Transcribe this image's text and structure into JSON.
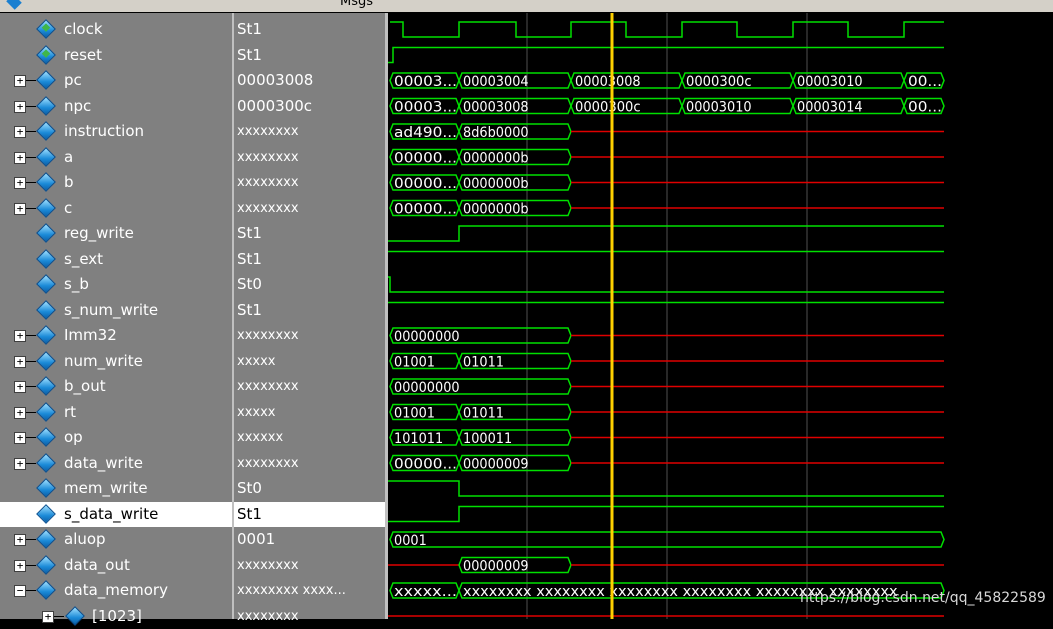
{
  "header": {
    "value_column_label": "Msgs"
  },
  "signals": [
    {
      "name": "clock",
      "value": "St1",
      "expandable": false,
      "icon": "clock-icon"
    },
    {
      "name": "reset",
      "value": "St1",
      "expandable": false,
      "icon": "clock-icon"
    },
    {
      "name": "pc",
      "value": "00003008",
      "expandable": true,
      "icon": "signal-icon"
    },
    {
      "name": "npc",
      "value": "0000300c",
      "expandable": true,
      "icon": "signal-icon"
    },
    {
      "name": "instruction",
      "value": "xxxxxxxx",
      "expandable": true,
      "icon": "signal-icon"
    },
    {
      "name": "a",
      "value": "xxxxxxxx",
      "expandable": true,
      "icon": "signal-icon"
    },
    {
      "name": "b",
      "value": "xxxxxxxx",
      "expandable": true,
      "icon": "signal-icon"
    },
    {
      "name": "c",
      "value": "xxxxxxxx",
      "expandable": true,
      "icon": "signal-icon"
    },
    {
      "name": "reg_write",
      "value": "St1",
      "expandable": false,
      "icon": "signal-icon"
    },
    {
      "name": "s_ext",
      "value": "St1",
      "expandable": false,
      "icon": "signal-icon"
    },
    {
      "name": "s_b",
      "value": "St0",
      "expandable": false,
      "icon": "signal-icon"
    },
    {
      "name": "s_num_write",
      "value": "St1",
      "expandable": false,
      "icon": "signal-icon"
    },
    {
      "name": "Imm32",
      "value": "xxxxxxxx",
      "expandable": true,
      "icon": "signal-icon"
    },
    {
      "name": "num_write",
      "value": "xxxxx",
      "expandable": true,
      "icon": "signal-icon"
    },
    {
      "name": "b_out",
      "value": "xxxxxxxx",
      "expandable": true,
      "icon": "signal-icon"
    },
    {
      "name": "rt",
      "value": "xxxxx",
      "expandable": true,
      "icon": "signal-icon"
    },
    {
      "name": "op",
      "value": "xxxxxx",
      "expandable": true,
      "icon": "signal-icon"
    },
    {
      "name": "data_write",
      "value": "xxxxxxxx",
      "expandable": true,
      "icon": "signal-icon"
    },
    {
      "name": "mem_write",
      "value": "St0",
      "expandable": false,
      "icon": "signal-icon"
    },
    {
      "name": "s_data_write",
      "value": "St1",
      "expandable": false,
      "icon": "signal-icon",
      "selected": true
    },
    {
      "name": "aluop",
      "value": "0001",
      "expandable": true,
      "icon": "signal-icon"
    },
    {
      "name": "data_out",
      "value": "xxxxxxxx",
      "expandable": true,
      "icon": "signal-icon"
    },
    {
      "name": "data_memory",
      "value": "xxxxxxxx xxxx...",
      "expandable": true,
      "expanded": true,
      "icon": "signal-icon"
    },
    {
      "name": "[1023]",
      "value": "xxxxxxxx",
      "expandable": true,
      "icon": "signal-icon",
      "indent": true
    }
  ],
  "wave_labels": {
    "pc": [
      "00003...",
      "00003004",
      "00003008",
      "0000300c",
      "00003010",
      "00..."
    ],
    "npc": [
      "00003...",
      "00003008",
      "0000300c",
      "00003010",
      "00003014",
      "00..."
    ],
    "instruction": [
      "ad490...",
      "8d6b0000"
    ],
    "a": [
      "00000...",
      "0000000b"
    ],
    "b": [
      "00000...",
      "0000000b"
    ],
    "c": [
      "00000...",
      "0000000b"
    ],
    "Imm32": [
      "00000000"
    ],
    "num_write": [
      "01001",
      "01011"
    ],
    "b_out": [
      "00000000"
    ],
    "rt": [
      "01001",
      "01011"
    ],
    "op": [
      "101011",
      "100011"
    ],
    "data_write": [
      "00000...",
      "00000009"
    ],
    "aluop": [
      "0001"
    ],
    "data_out": [
      "00000009"
    ],
    "data_memory": [
      "xxxxx...",
      "xxxxxxxx xxxxxxxx xxxxxxxx xxxxxxxx xxxxxxxx xxxxxxxx"
    ]
  },
  "watermark": "https://blog.csdn.net/qq_45822589",
  "colors": {
    "wave_green": "#00e000",
    "wave_red": "#e00000",
    "cursor": "#ffd000",
    "grid": "#505050",
    "bus_text": "#ffffff"
  }
}
